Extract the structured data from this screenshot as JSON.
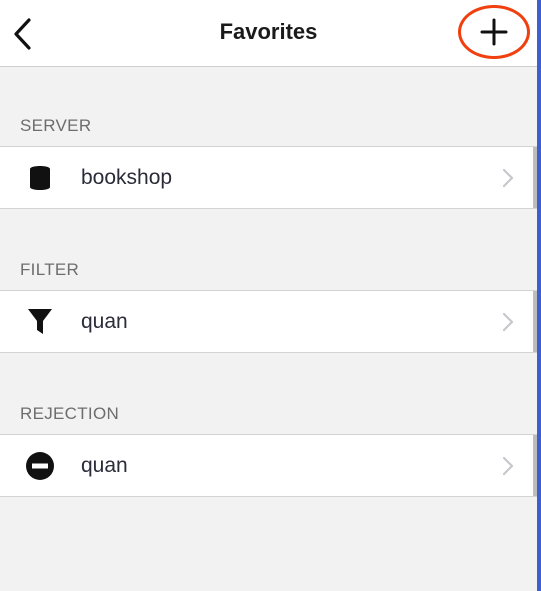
{
  "nav": {
    "title": "Favorites",
    "back_icon": "chevron-left-icon",
    "add_icon": "plus-icon",
    "highlight_color": "#f0400f"
  },
  "sections": [
    {
      "header": "SERVER",
      "items": [
        {
          "label": "bookshop",
          "icon": "database-icon"
        }
      ]
    },
    {
      "header": "FILTER",
      "items": [
        {
          "label": "quan",
          "icon": "funnel-icon"
        }
      ]
    },
    {
      "header": "REJECTION",
      "items": [
        {
          "label": "quan",
          "icon": "minus-circle-icon"
        }
      ]
    }
  ],
  "colors": {
    "background": "#f2f2f2",
    "row_background": "#ffffff",
    "header_text": "#6d6d6d",
    "chevron": "#c7c7cc",
    "accent_edge": "#3d5fcf"
  }
}
